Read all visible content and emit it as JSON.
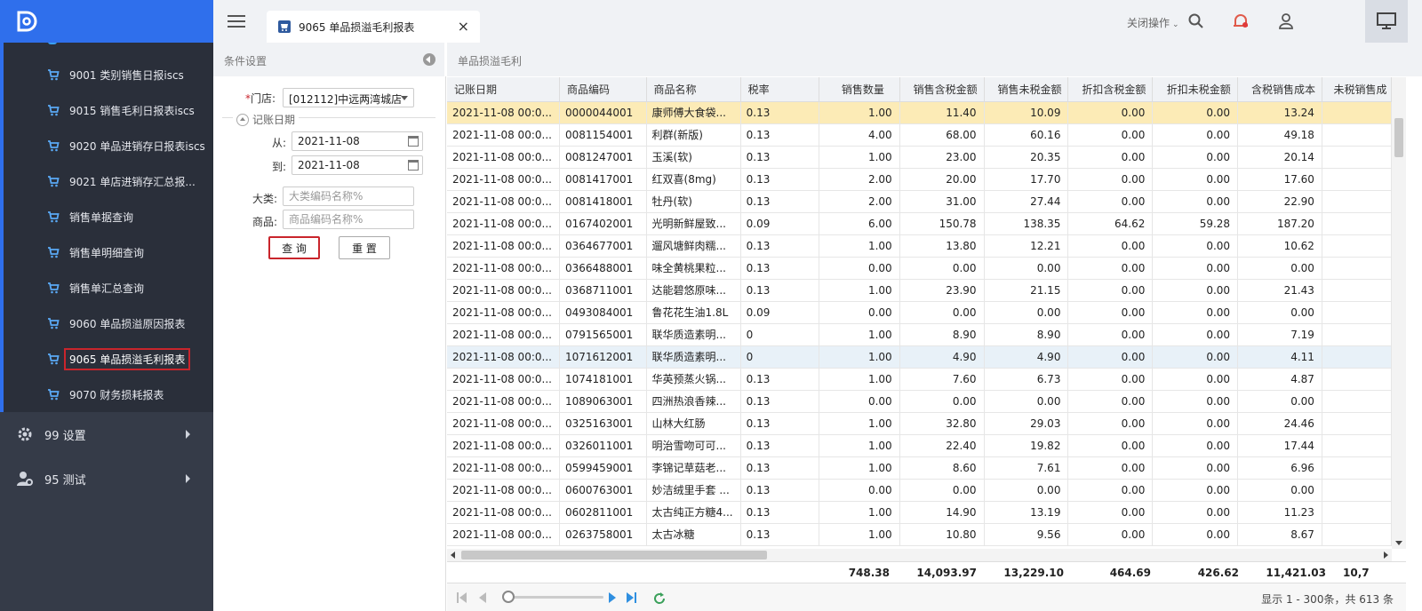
{
  "sidebar": {
    "items": [
      {
        "label": "9001 类别销售日报iscs"
      },
      {
        "label": "9015 销售毛利日报表iscs"
      },
      {
        "label": "9020 单品进销存日报表iscs"
      },
      {
        "label": "9021 单店进销存汇总报..."
      },
      {
        "label": "销售单据查询"
      },
      {
        "label": "销售单明细查询"
      },
      {
        "label": "销售单汇总查询"
      },
      {
        "label": "9060 单品损溢原因报表"
      },
      {
        "label": "9065 单品损溢毛利报表"
      },
      {
        "label": "9070 财务损耗报表"
      }
    ],
    "menus": [
      {
        "label": "99 设置"
      },
      {
        "label": "95 测试"
      }
    ]
  },
  "topbar": {
    "tab_title": "9065 单品损溢毛利报表",
    "tab_close": "×",
    "close_ops": "关闭操作"
  },
  "conditions": {
    "header": "条件设置",
    "store_label": "门店:",
    "store_required": "*",
    "store_value": "[012112]中远两湾城店",
    "date_group": "记账日期",
    "from_label": "从:",
    "from_value": "2021-11-08",
    "to_label": "到:",
    "to_value": "2021-11-08",
    "category_label": "大类:",
    "category_placeholder": "大类编码名称%",
    "product_label": "商品:",
    "product_placeholder": "商品编码名称%",
    "query_button": "查 询",
    "reset_button": "重 置"
  },
  "grid": {
    "title": "单品损溢毛利",
    "columns": [
      "记账日期",
      "商品编码",
      "商品名称",
      "税率",
      "销售数量",
      "销售含税金额",
      "销售未税金额",
      "折扣含税金额",
      "折扣未税金额",
      "含税销售成本",
      "未税销售成"
    ],
    "rows": [
      [
        "2021-11-08 00:0...",
        "0000044001",
        "康师傅大食袋...",
        "0.13",
        "1.00",
        "11.40",
        "10.09",
        "0.00",
        "0.00",
        "13.24"
      ],
      [
        "2021-11-08 00:0...",
        "0081154001",
        "利群(新版)",
        "0.13",
        "4.00",
        "68.00",
        "60.16",
        "0.00",
        "0.00",
        "49.18"
      ],
      [
        "2021-11-08 00:0...",
        "0081247001",
        "玉溪(软)",
        "0.13",
        "1.00",
        "23.00",
        "20.35",
        "0.00",
        "0.00",
        "20.14"
      ],
      [
        "2021-11-08 00:0...",
        "0081417001",
        "红双喜(8mg)",
        "0.13",
        "2.00",
        "20.00",
        "17.70",
        "0.00",
        "0.00",
        "17.60"
      ],
      [
        "2021-11-08 00:0...",
        "0081418001",
        "牡丹(软)",
        "0.13",
        "2.00",
        "31.00",
        "27.44",
        "0.00",
        "0.00",
        "22.90"
      ],
      [
        "2021-11-08 00:0...",
        "0167402001",
        "光明新鲜屋致...",
        "0.09",
        "6.00",
        "150.78",
        "138.35",
        "64.62",
        "59.28",
        "187.20"
      ],
      [
        "2021-11-08 00:0...",
        "0364677001",
        "遛风塘鲜肉糯...",
        "0.13",
        "1.00",
        "13.80",
        "12.21",
        "0.00",
        "0.00",
        "10.62"
      ],
      [
        "2021-11-08 00:0...",
        "0366488001",
        "味全黄桃果粒...",
        "0.13",
        "0.00",
        "0.00",
        "0.00",
        "0.00",
        "0.00",
        "0.00"
      ],
      [
        "2021-11-08 00:0...",
        "0368711001",
        "达能碧悠原味...",
        "0.13",
        "1.00",
        "23.90",
        "21.15",
        "0.00",
        "0.00",
        "21.43"
      ],
      [
        "2021-11-08 00:0...",
        "0493084001",
        "鲁花花生油1.8L",
        "0.09",
        "0.00",
        "0.00",
        "0.00",
        "0.00",
        "0.00",
        "0.00"
      ],
      [
        "2021-11-08 00:0...",
        "0791565001",
        "联华质造素明...",
        "0",
        "1.00",
        "8.90",
        "8.90",
        "0.00",
        "0.00",
        "7.19"
      ],
      [
        "2021-11-08 00:0...",
        "1071612001",
        "联华质造素明...",
        "0",
        "1.00",
        "4.90",
        "4.90",
        "0.00",
        "0.00",
        "4.11"
      ],
      [
        "2021-11-08 00:0...",
        "1074181001",
        "华英预蒸火锅...",
        "0.13",
        "1.00",
        "7.60",
        "6.73",
        "0.00",
        "0.00",
        "4.87"
      ],
      [
        "2021-11-08 00:0...",
        "1089063001",
        "四洲热浪香辣...",
        "0.13",
        "0.00",
        "0.00",
        "0.00",
        "0.00",
        "0.00",
        "0.00"
      ],
      [
        "2021-11-08 00:0...",
        "0325163001",
        "山林大红肠",
        "0.13",
        "1.00",
        "32.80",
        "29.03",
        "0.00",
        "0.00",
        "24.46"
      ],
      [
        "2021-11-08 00:0...",
        "0326011001",
        "明治雪吻可可...",
        "0.13",
        "1.00",
        "22.40",
        "19.82",
        "0.00",
        "0.00",
        "17.44"
      ],
      [
        "2021-11-08 00:0...",
        "0599459001",
        "李锦记草菇老...",
        "0.13",
        "1.00",
        "8.60",
        "7.61",
        "0.00",
        "0.00",
        "6.96"
      ],
      [
        "2021-11-08 00:0...",
        "0600763001",
        "妙洁绒里手套 ...",
        "0.13",
        "0.00",
        "0.00",
        "0.00",
        "0.00",
        "0.00",
        "0.00"
      ],
      [
        "2021-11-08 00:0...",
        "0602811001",
        "太古纯正方糖4...",
        "0.13",
        "1.00",
        "14.90",
        "13.19",
        "0.00",
        "0.00",
        "11.23"
      ],
      [
        "2021-11-08 00:0...",
        "0263758001",
        "太古冰糖",
        "0.13",
        "1.00",
        "10.80",
        "9.56",
        "0.00",
        "0.00",
        "8.67"
      ]
    ],
    "totals": [
      "748.38",
      "14,093.97",
      "13,229.10",
      "464.69",
      "426.62",
      "11,421.03",
      "10,7"
    ]
  },
  "pager": {
    "info": "显示 1 - 300条，共 613 条"
  },
  "colors": {
    "brand_blue": "#2f6fec",
    "sidebar_bg": "#353b48",
    "selected_row": "#fcebb6",
    "highlight_border": "#c9252c"
  }
}
